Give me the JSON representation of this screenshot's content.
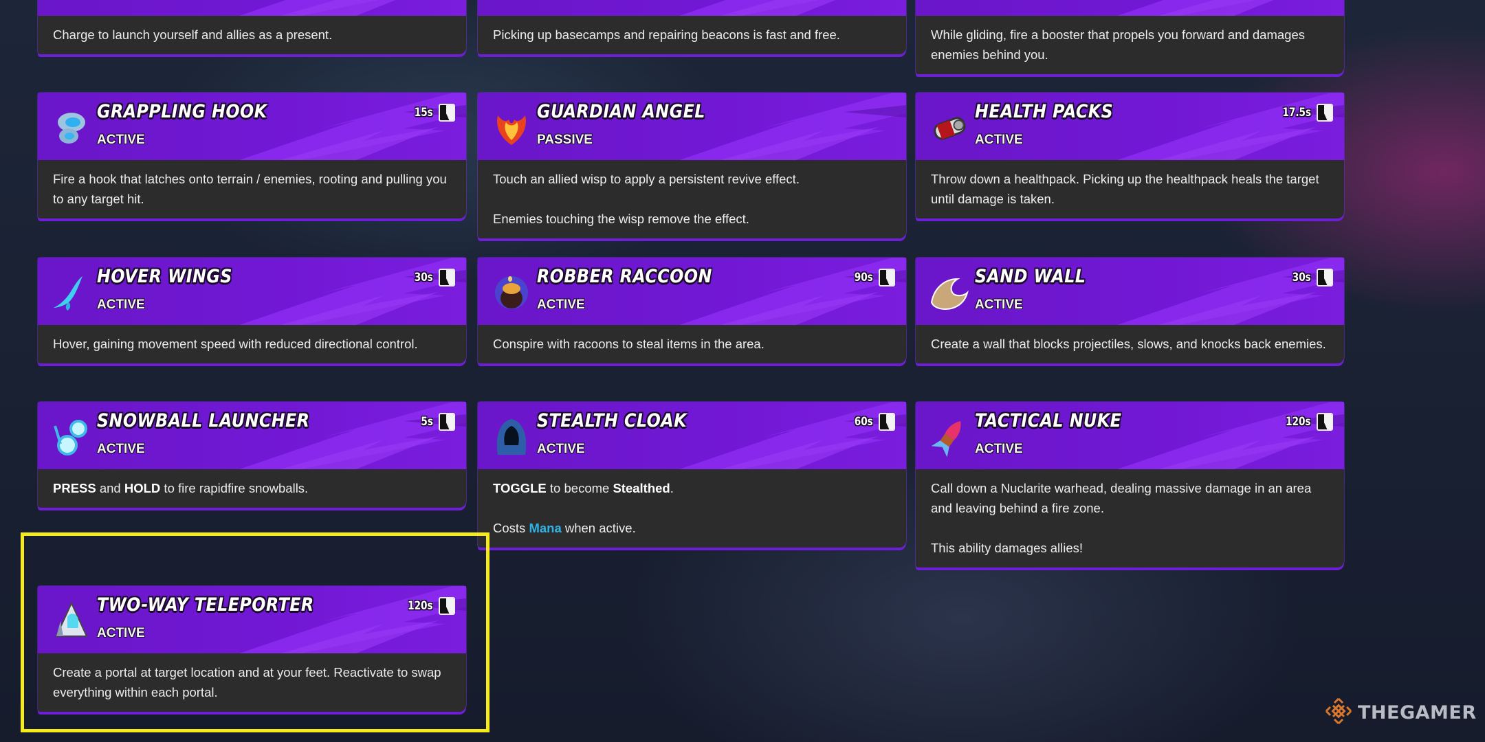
{
  "colors": {
    "card_header": "#7118d4",
    "card_body": "#2c2c2c",
    "highlight": "#f5ea1e",
    "mana": "#2fb3e6",
    "watermark_logo": "#d9772c"
  },
  "cards": [
    {
      "title": "",
      "type": "",
      "cooldown": "",
      "icon": "present-icon",
      "body": [
        "Charge to launch yourself and allies as a present."
      ]
    },
    {
      "title": "",
      "type": "",
      "cooldown": "",
      "icon": "basecamp-icon",
      "body": [
        "Picking up basecamps and repairing beacons is fast and free."
      ]
    },
    {
      "title": "",
      "type": "",
      "cooldown": "",
      "icon": "booster-icon",
      "body": [
        "While gliding, fire a booster that propels you forward and damages enemies behind you."
      ]
    },
    {
      "title": "GRAPPLING HOOK",
      "type": "ACTIVE",
      "cooldown": "15s",
      "icon": "grappling-hook-icon",
      "body": [
        "Fire a hook that latches onto terrain / enemies, rooting and pulling you to any target hit."
      ]
    },
    {
      "title": "GUARDIAN ANGEL",
      "type": "PASSIVE",
      "cooldown": "",
      "icon": "phoenix-icon",
      "body": [
        "Touch an allied wisp to apply a persistent revive effect.",
        "Enemies touching the wisp remove the effect."
      ]
    },
    {
      "title": "HEALTH PACKS",
      "type": "ACTIVE",
      "cooldown": "17.5s",
      "icon": "health-pack-icon",
      "body": [
        "Throw down a healthpack. Picking up the healthpack heals the target until damage is taken."
      ]
    },
    {
      "title": "HOVER WINGS",
      "type": "ACTIVE",
      "cooldown": "30s",
      "icon": "wing-icon",
      "body": [
        "Hover, gaining movement speed with reduced directional control."
      ]
    },
    {
      "title": "ROBBER RACCOON",
      "type": "ACTIVE",
      "cooldown": "90s",
      "icon": "loot-pot-icon",
      "body": [
        "Conspire with racoons to steal items in the area."
      ]
    },
    {
      "title": "SAND WALL",
      "type": "ACTIVE",
      "cooldown": "30s",
      "icon": "sand-wave-icon",
      "body": [
        "Create a wall that blocks projectiles, slows, and knocks back enemies."
      ]
    },
    {
      "title": "SNOWBALL LAUNCHER",
      "type": "ACTIVE",
      "cooldown": "5s",
      "icon": "snowball-icon",
      "body_rich": [
        [
          {
            "b": "PRESS"
          },
          {
            "t": " and "
          },
          {
            "b": "HOLD"
          },
          {
            "t": " to fire rapidfire snowballs."
          }
        ]
      ]
    },
    {
      "title": "STEALTH CLOAK",
      "type": "ACTIVE",
      "cooldown": "60s",
      "icon": "hood-icon",
      "body_rich": [
        [
          {
            "b": "TOGGLE"
          },
          {
            "t": " to become "
          },
          {
            "b": "Stealthed"
          },
          {
            "t": "."
          }
        ],
        [
          {
            "t": "Costs "
          },
          {
            "m": "Mana"
          },
          {
            "t": " when active."
          }
        ]
      ]
    },
    {
      "title": "TACTICAL NUKE",
      "type": "ACTIVE",
      "cooldown": "120s",
      "icon": "warhead-icon",
      "body": [
        "Call down a Nuclarite warhead, dealing massive damage in an area and leaving behind a fire zone.",
        "This ability damages allies!"
      ]
    },
    {
      "title": "TWO-WAY TELEPORTER",
      "type": "ACTIVE",
      "cooldown": "120s",
      "icon": "teleporter-icon",
      "body": [
        "Create a portal at target location and at your feet. Reactivate to swap everything within each portal."
      ]
    }
  ],
  "highlighted_card": "TWO-WAY TELEPORTER",
  "watermark": {
    "text": "THEGAMER",
    "icon": "thegamer-logo-icon"
  }
}
